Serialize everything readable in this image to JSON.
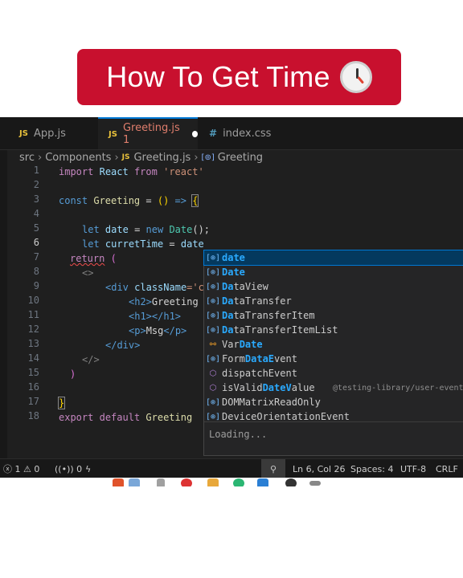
{
  "banner": {
    "title": "How To Get Time",
    "emoji": "🕛"
  },
  "tabs": [
    {
      "icon": "JS",
      "label": "App.js"
    },
    {
      "icon": "JS",
      "label": "Greeting.js 1"
    },
    {
      "icon": "#",
      "label": "index.css"
    }
  ],
  "breadcrumb": {
    "items": [
      "src",
      "Components",
      "Greeting.js",
      "Greeting"
    ]
  },
  "line_numbers": [
    "1",
    "2",
    "3",
    "4",
    "5",
    "6",
    "7",
    "8",
    "9",
    "10",
    "11",
    "12",
    "13",
    "14",
    "15",
    "16",
    "17",
    "18"
  ],
  "code": {
    "l1": [
      "import",
      "React",
      "from",
      "'react'"
    ],
    "l3": [
      "const",
      "Greeting",
      "=",
      "()",
      "=>",
      "{"
    ],
    "l5": [
      "let",
      "date",
      "=",
      "new",
      "Date",
      "();"
    ],
    "l6": [
      "let",
      "curretTime",
      "=",
      "date"
    ],
    "l7": [
      "return",
      "("
    ],
    "l8": "<>",
    "l9": [
      "<div",
      "className",
      "='c"
    ],
    "l10": [
      "<h2>",
      "Greeting"
    ],
    "l11": [
      "<h1>",
      "</h1>"
    ],
    "l12": [
      "<p>",
      "Msg",
      "</p>"
    ],
    "l13": "</div>",
    "l14": "</>",
    "l15": ")",
    "l17": "}",
    "l18": [
      "export",
      "default",
      "Greeting"
    ]
  },
  "suggestions": [
    {
      "pre": "",
      "hl": "date",
      "post": "",
      "kind": "variable"
    },
    {
      "pre": "",
      "hl": "Date",
      "post": "",
      "kind": "variable"
    },
    {
      "pre": "",
      "hl": "Da",
      "post": "taView",
      "kind": "variable"
    },
    {
      "pre": "",
      "hl": "Da",
      "post": "taTransfer",
      "kind": "variable"
    },
    {
      "pre": "",
      "hl": "Da",
      "post": "taTransferItem",
      "kind": "variable"
    },
    {
      "pre": "",
      "hl": "Da",
      "post": "taTransferItemList",
      "kind": "variable"
    },
    {
      "pre": "Var",
      "hl": "Date",
      "post": "",
      "kind": "type"
    },
    {
      "pre": "Form",
      "hl": "DataE",
      "post": "vent",
      "kind": "variable"
    },
    {
      "pre": "dispatchEvent",
      "hl": "",
      "post": "",
      "kind": "method"
    },
    {
      "pre": "isValid",
      "hl": "DateV",
      "post": "alue",
      "kind": "method",
      "detail": "@testing-library/user-event"
    },
    {
      "pre": "DOMMatrixReadOnly",
      "hl": "",
      "post": "",
      "kind": "variable"
    },
    {
      "pre": "DeviceOrientationEvent",
      "hl": "",
      "post": "",
      "kind": "variable"
    }
  ],
  "loading": "Loading...",
  "status": {
    "errors": "1",
    "warnings": "0",
    "ports": "0",
    "position": "Ln 6, Col 26",
    "spaces": "Spaces: 4",
    "encoding": "UTF-8",
    "eol": "CRLF"
  },
  "colors": {
    "banner": "#c8102e",
    "editor_bg": "#1f1f1f",
    "selection": "#04395e",
    "accent": "#0078d4"
  }
}
